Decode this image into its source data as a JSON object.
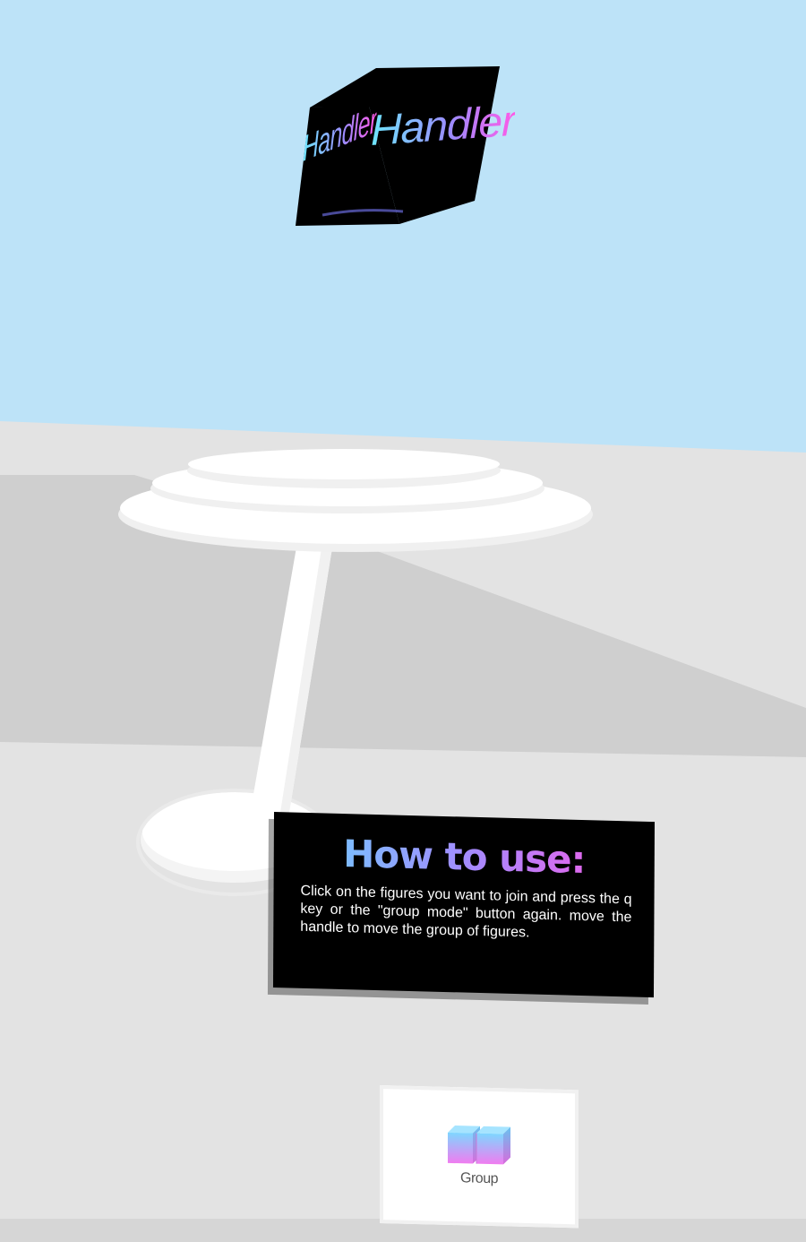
{
  "handle_cube": {
    "front_text": "Handler",
    "side_text": "Handler"
  },
  "howto": {
    "title": "How to use:",
    "body": "Click on the figures you want to join and press the q key or the \"group mode\" button again. move the handle to move the group of figures."
  },
  "group_button": {
    "label": "Group",
    "icon": "group-cubes-icon"
  },
  "colors": {
    "sky": "#bde3f8",
    "floor": "#e3e3e3",
    "floor_shadow": "#cfcfcf",
    "gradient_start": "#68d8ff",
    "gradient_mid": "#a28cff",
    "gradient_end": "#ff55e4",
    "panel": "#000000"
  }
}
